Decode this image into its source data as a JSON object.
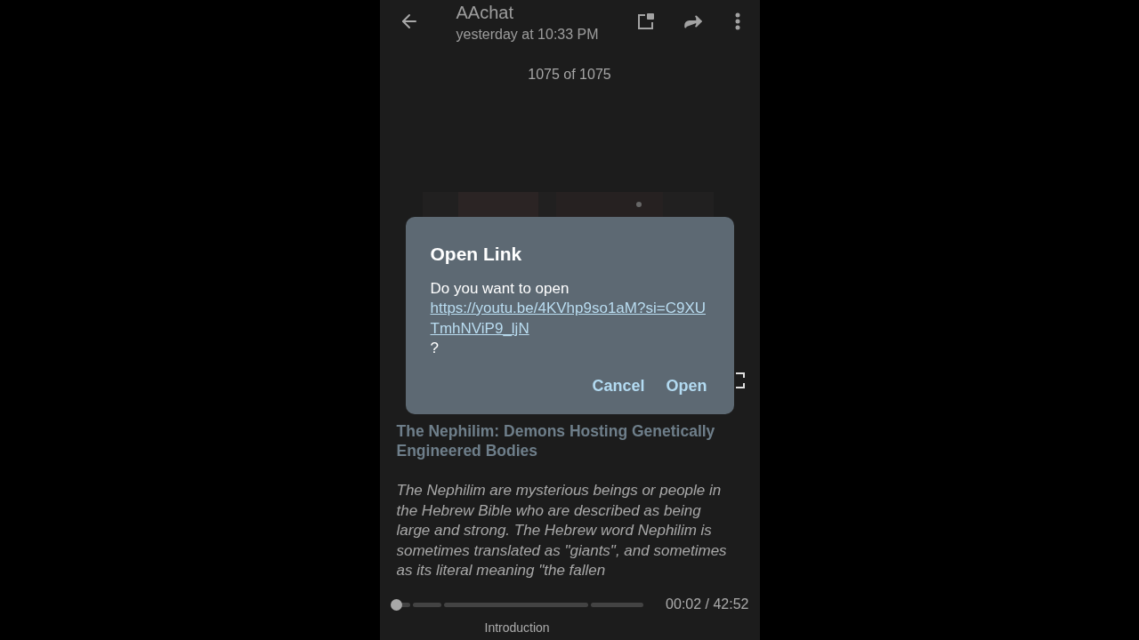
{
  "header": {
    "title": "AAchat",
    "subtitle": "yesterday at 10:33 PM"
  },
  "counter": "1075 of 1075",
  "dialog": {
    "title": "Open Link",
    "prompt": "Do you want to open ",
    "link": "https://youtu.be/4KVhp9so1aM?si=C9XUTmhNViP9_ljN",
    "suffix": "?",
    "buttons": [
      "Cancel",
      "Open"
    ]
  },
  "post": {
    "title": "The Nephilim: Demons Hosting Genetically Engineered Bodies",
    "body": "The Nephilim are mysterious beings or people in the Hebrew Bible who are described as being large and strong. The Hebrew word Nephilim is sometimes translated as \"giants\", and sometimes as its literal meaning \"the fallen"
  },
  "player": {
    "level": 0.0,
    "time": "00:02 / 42:52",
    "chapter": "Introduction"
  }
}
